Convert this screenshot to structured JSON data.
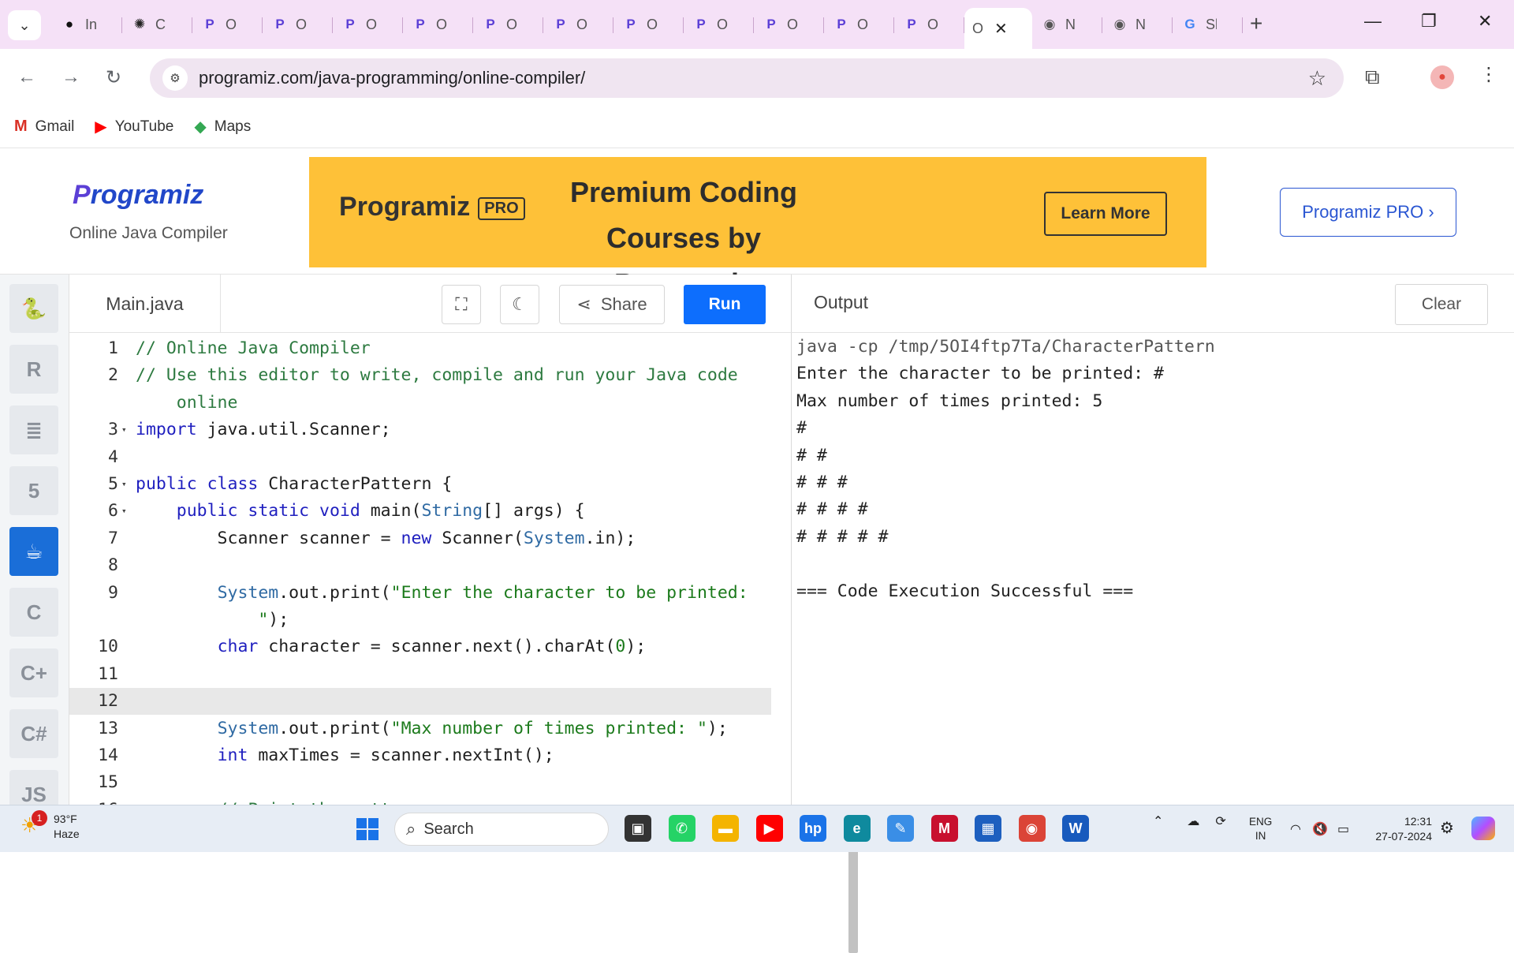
{
  "browser": {
    "tabs": [
      {
        "icon": "github-icon",
        "title": "In",
        "color": "#111111",
        "glyph": "●"
      },
      {
        "icon": "chatgpt-icon",
        "title": "Cl",
        "color": "#222222",
        "glyph": "✺"
      },
      {
        "icon": "programiz-icon",
        "title": "O",
        "color": "#5b3fd6",
        "glyph": "P"
      },
      {
        "icon": "programiz-icon",
        "title": "O",
        "color": "#5b3fd6",
        "glyph": "P"
      },
      {
        "icon": "programiz-icon",
        "title": "O",
        "color": "#5b3fd6",
        "glyph": "P"
      },
      {
        "icon": "programiz-icon",
        "title": "O",
        "color": "#5b3fd6",
        "glyph": "P"
      },
      {
        "icon": "programiz-icon",
        "title": "O",
        "color": "#5b3fd6",
        "glyph": "P"
      },
      {
        "icon": "programiz-icon",
        "title": "O",
        "color": "#5b3fd6",
        "glyph": "P"
      },
      {
        "icon": "programiz-icon",
        "title": "O",
        "color": "#5b3fd6",
        "glyph": "P"
      },
      {
        "icon": "programiz-icon",
        "title": "O",
        "color": "#5b3fd6",
        "glyph": "P"
      },
      {
        "icon": "programiz-icon",
        "title": "O",
        "color": "#5b3fd6",
        "glyph": "P"
      },
      {
        "icon": "programiz-icon",
        "title": "O",
        "color": "#5b3fd6",
        "glyph": "P"
      },
      {
        "icon": "programiz-icon",
        "title": "O",
        "color": "#5b3fd6",
        "glyph": "P"
      }
    ],
    "active_tab": {
      "title": "O",
      "close": "✕"
    },
    "tabs_after": [
      {
        "icon": "chrome-icon",
        "title": "N",
        "color": "#555555",
        "glyph": "◉"
      },
      {
        "icon": "chrome-icon",
        "title": "N",
        "color": "#555555",
        "glyph": "◉"
      },
      {
        "icon": "google-icon",
        "title": "Sk",
        "color": "#4285f4",
        "glyph": "G"
      }
    ],
    "url": "programiz.com/java-programming/online-compiler/",
    "bookmarks": [
      {
        "icon": "gmail-icon",
        "label": "Gmail",
        "glyph": "M",
        "color": "#d93025"
      },
      {
        "icon": "youtube-icon",
        "label": "YouTube",
        "glyph": "▶",
        "color": "#ff0000"
      },
      {
        "icon": "maps-icon",
        "label": "Maps",
        "glyph": "◆",
        "color": "#34a853"
      }
    ]
  },
  "site": {
    "logo_text": "rogramiz",
    "subtitle": "Online Java Compiler",
    "banner": {
      "logo": "rogramiz",
      "pro": "PRO",
      "title_line1": "Premium Coding",
      "title_line2": "Courses by Programiz",
      "cta": "Learn More"
    },
    "pro_button": "Programiz PRO ›"
  },
  "rail": [
    {
      "icon": "python-icon",
      "glyph": "🐍",
      "active": false
    },
    {
      "icon": "r-icon",
      "glyph": "R",
      "active": false
    },
    {
      "icon": "sql-icon",
      "glyph": "≣",
      "active": false
    },
    {
      "icon": "html5-icon",
      "glyph": "5",
      "active": false
    },
    {
      "icon": "java-icon",
      "glyph": "☕",
      "active": true
    },
    {
      "icon": "c-icon",
      "glyph": "C",
      "active": false
    },
    {
      "icon": "cplusplus-icon",
      "glyph": "C+",
      "active": false
    },
    {
      "icon": "csharp-icon",
      "glyph": "C#",
      "active": false
    },
    {
      "icon": "javascript-icon",
      "glyph": "JS",
      "active": false
    }
  ],
  "editor": {
    "filename": "Main.java",
    "share": "Share",
    "run": "Run",
    "lines": [
      {
        "n": "1",
        "fold": false,
        "html": "<span class=\"cm\">// Online Java Compiler</span>"
      },
      {
        "n": "2",
        "fold": false,
        "html": "<span class=\"cm\">// Use this editor to write, compile and run your Java code</span>"
      },
      {
        "n": "",
        "fold": false,
        "html": "<span class=\"cm\">    online</span>"
      },
      {
        "n": "3",
        "fold": true,
        "html": "<span class=\"kw\">import</span> java.util.Scanner;"
      },
      {
        "n": "4",
        "fold": false,
        "html": ""
      },
      {
        "n": "5",
        "fold": true,
        "html": "<span class=\"kw\">public class</span> CharacterPattern {"
      },
      {
        "n": "6",
        "fold": true,
        "html": "    <span class=\"kw\">public static void</span> main(<span class=\"ty\">String</span>[] args) {"
      },
      {
        "n": "7",
        "fold": false,
        "html": "        Scanner scanner = <span class=\"kw\">new</span> Scanner(<span class=\"ty\">System</span>.in);"
      },
      {
        "n": "8",
        "fold": false,
        "html": ""
      },
      {
        "n": "9",
        "fold": false,
        "html": "        <span class=\"ty\">System</span>.out.print(<span class=\"st\">\"Enter the character to be printed:</span>"
      },
      {
        "n": "",
        "fold": false,
        "html": "<span class=\"st\">            \"</span>);"
      },
      {
        "n": "10",
        "fold": false,
        "html": "        <span class=\"kw\">char</span> character = scanner.next().charAt(<span class=\"nm\">0</span>);"
      },
      {
        "n": "11",
        "fold": false,
        "html": ""
      },
      {
        "n": "12",
        "fold": false,
        "html": "",
        "current": true
      },
      {
        "n": "13",
        "fold": false,
        "html": "        <span class=\"ty\">System</span>.out.print(<span class=\"st\">\"Max number of times printed: \"</span>);"
      },
      {
        "n": "14",
        "fold": false,
        "html": "        <span class=\"kw\">int</span> maxTimes = scanner.nextInt();"
      },
      {
        "n": "15",
        "fold": false,
        "html": ""
      },
      {
        "n": "16",
        "fold": false,
        "html": "        <span class=\"cm\">// Print the pattern</span>"
      }
    ]
  },
  "output": {
    "title": "Output",
    "clear": "Clear",
    "command": "java -cp /tmp/5OI4ftp7Ta/CharacterPattern",
    "lines": [
      "Enter the character to be printed: #",
      "Max number of times printed: 5",
      "#",
      "# #",
      "# # #",
      "# # # #",
      "# # # # #",
      "",
      "=== Code Execution Successful ==="
    ]
  },
  "taskbar": {
    "weather_temp": "93°F",
    "weather_desc": "Haze",
    "weather_badge": "1",
    "search": "Search",
    "apps": [
      {
        "icon": "task-view-icon",
        "color": "#333333",
        "glyph": "▣"
      },
      {
        "icon": "whatsapp-icon",
        "color": "#25d366",
        "glyph": "✆"
      },
      {
        "icon": "file-explorer-icon",
        "color": "#f4b400",
        "glyph": "▬"
      },
      {
        "icon": "youtube-icon",
        "color": "#ff0000",
        "glyph": "▶"
      },
      {
        "icon": "myhp-icon",
        "color": "#1a73e8",
        "glyph": "hp"
      },
      {
        "icon": "edge-icon",
        "color": "#0f8a9e",
        "glyph": "e"
      },
      {
        "icon": "copilot-icon",
        "color": "#3a8ee6",
        "glyph": "✎"
      },
      {
        "icon": "mcafee-icon",
        "color": "#c8102e",
        "glyph": "M"
      },
      {
        "icon": "store-icon",
        "color": "#1d5fbf",
        "glyph": "▦"
      },
      {
        "icon": "chrome-icon",
        "color": "#db4437",
        "glyph": "◉"
      },
      {
        "icon": "word-icon",
        "color": "#185abd",
        "glyph": "W"
      }
    ],
    "lang_line1": "ENG",
    "lang_line2": "IN",
    "time": "12:31",
    "date": "27-07-2024"
  }
}
